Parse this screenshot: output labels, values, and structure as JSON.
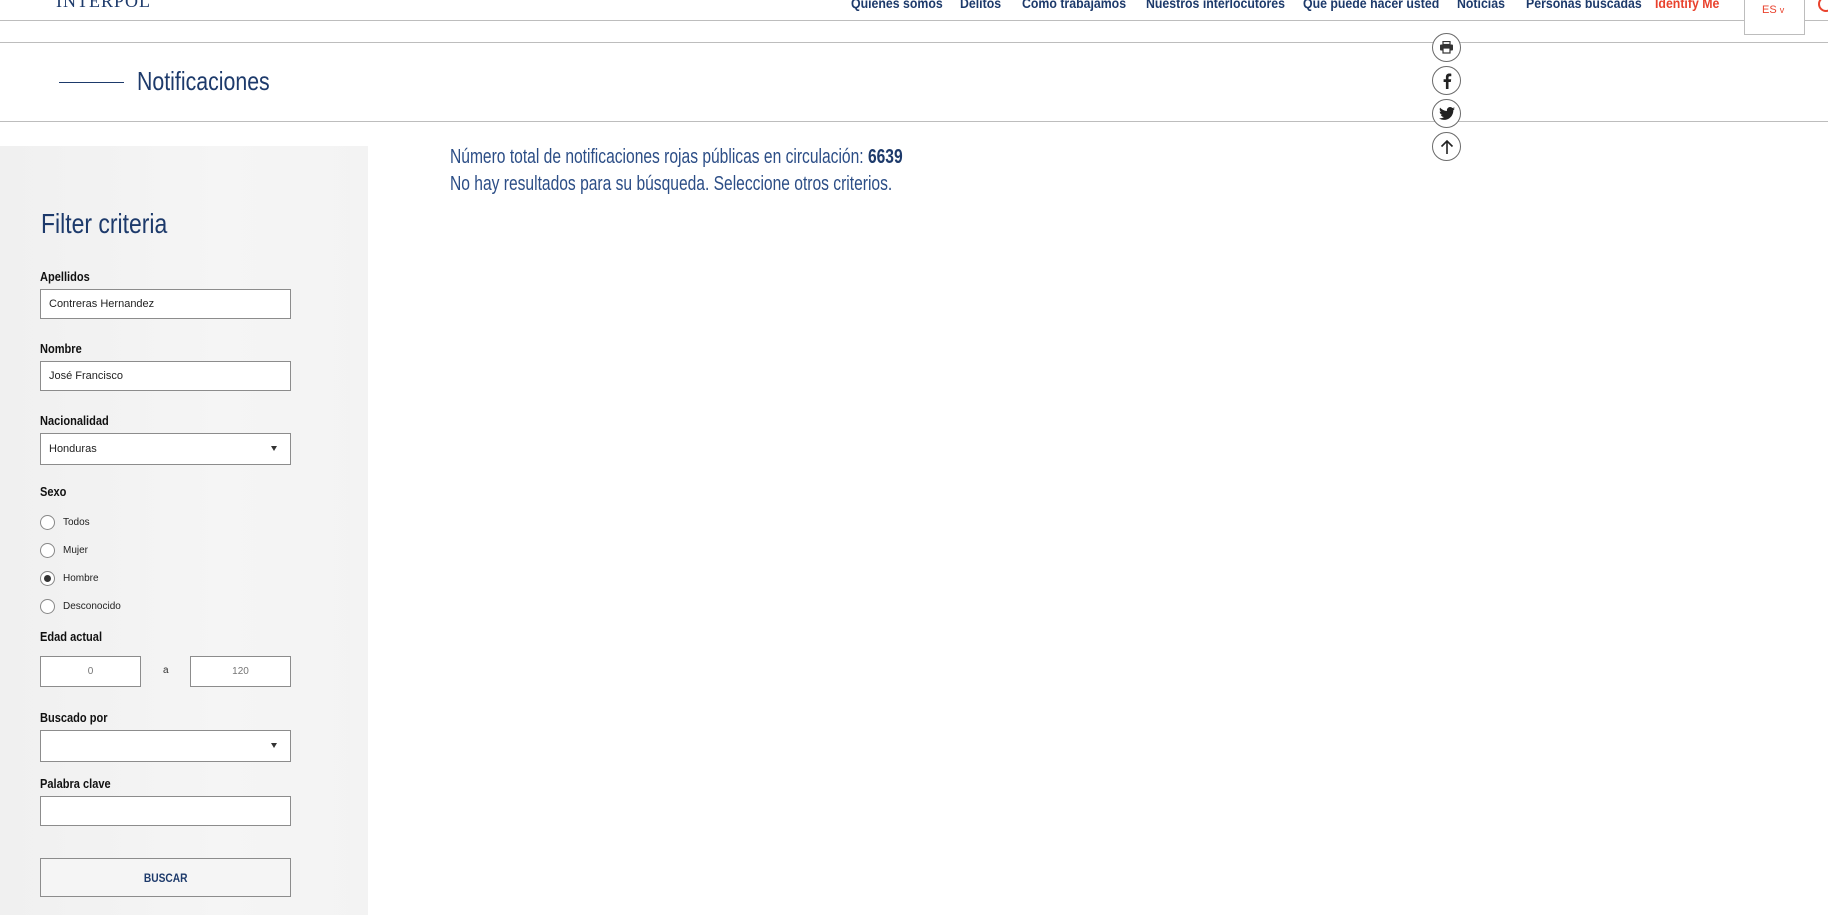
{
  "header": {
    "logo": "INTERPOL",
    "nav": [
      {
        "label": "Quiénes somos",
        "accent": false
      },
      {
        "label": "Delitos",
        "accent": false
      },
      {
        "label": "Cómo trabajamos",
        "accent": false
      },
      {
        "label": "Nuestros interlocutores",
        "accent": false
      },
      {
        "label": "Qué puede hacer usted",
        "accent": false
      },
      {
        "label": "Noticias",
        "accent": false
      },
      {
        "label": "Personas buscadas",
        "accent": false
      },
      {
        "label": "Identify Me",
        "accent": true
      }
    ],
    "language": "ES",
    "chevron": "v"
  },
  "page": {
    "title": "Notificaciones"
  },
  "share": [
    "printer-icon",
    "facebook-icon",
    "twitter-icon",
    "arrow-up-icon"
  ],
  "filter": {
    "title": "Filter criteria",
    "surname_label": "Apellidos",
    "surname_value": "Contreras Hernandez",
    "name_label": "Nombre",
    "name_value": "José Francisco",
    "nationality_label": "Nacionalidad",
    "nationality_value": "Honduras",
    "sex_label": "Sexo",
    "sex_options": [
      {
        "label": "Todos",
        "checked": false
      },
      {
        "label": "Mujer",
        "checked": false
      },
      {
        "label": "Hombre",
        "checked": true
      },
      {
        "label": "Desconocido",
        "checked": false
      }
    ],
    "age_label": "Edad actual",
    "age_min_placeholder": "0",
    "age_separator": "a",
    "age_max_placeholder": "120",
    "wanted_by_label": "Buscado por",
    "wanted_by_value": "",
    "keyword_label": "Palabra clave",
    "keyword_value": "",
    "submit_label": "BUSCAR"
  },
  "results": {
    "total_prefix": "Número total de notificaciones rojas públicas en circulación: ",
    "total_count": "6639",
    "no_results": "No hay resultados para su búsqueda. Seleccione otros criterios."
  },
  "colors": {
    "brand_blue": "#1d3a6b",
    "accent_red": "#e9422d"
  }
}
